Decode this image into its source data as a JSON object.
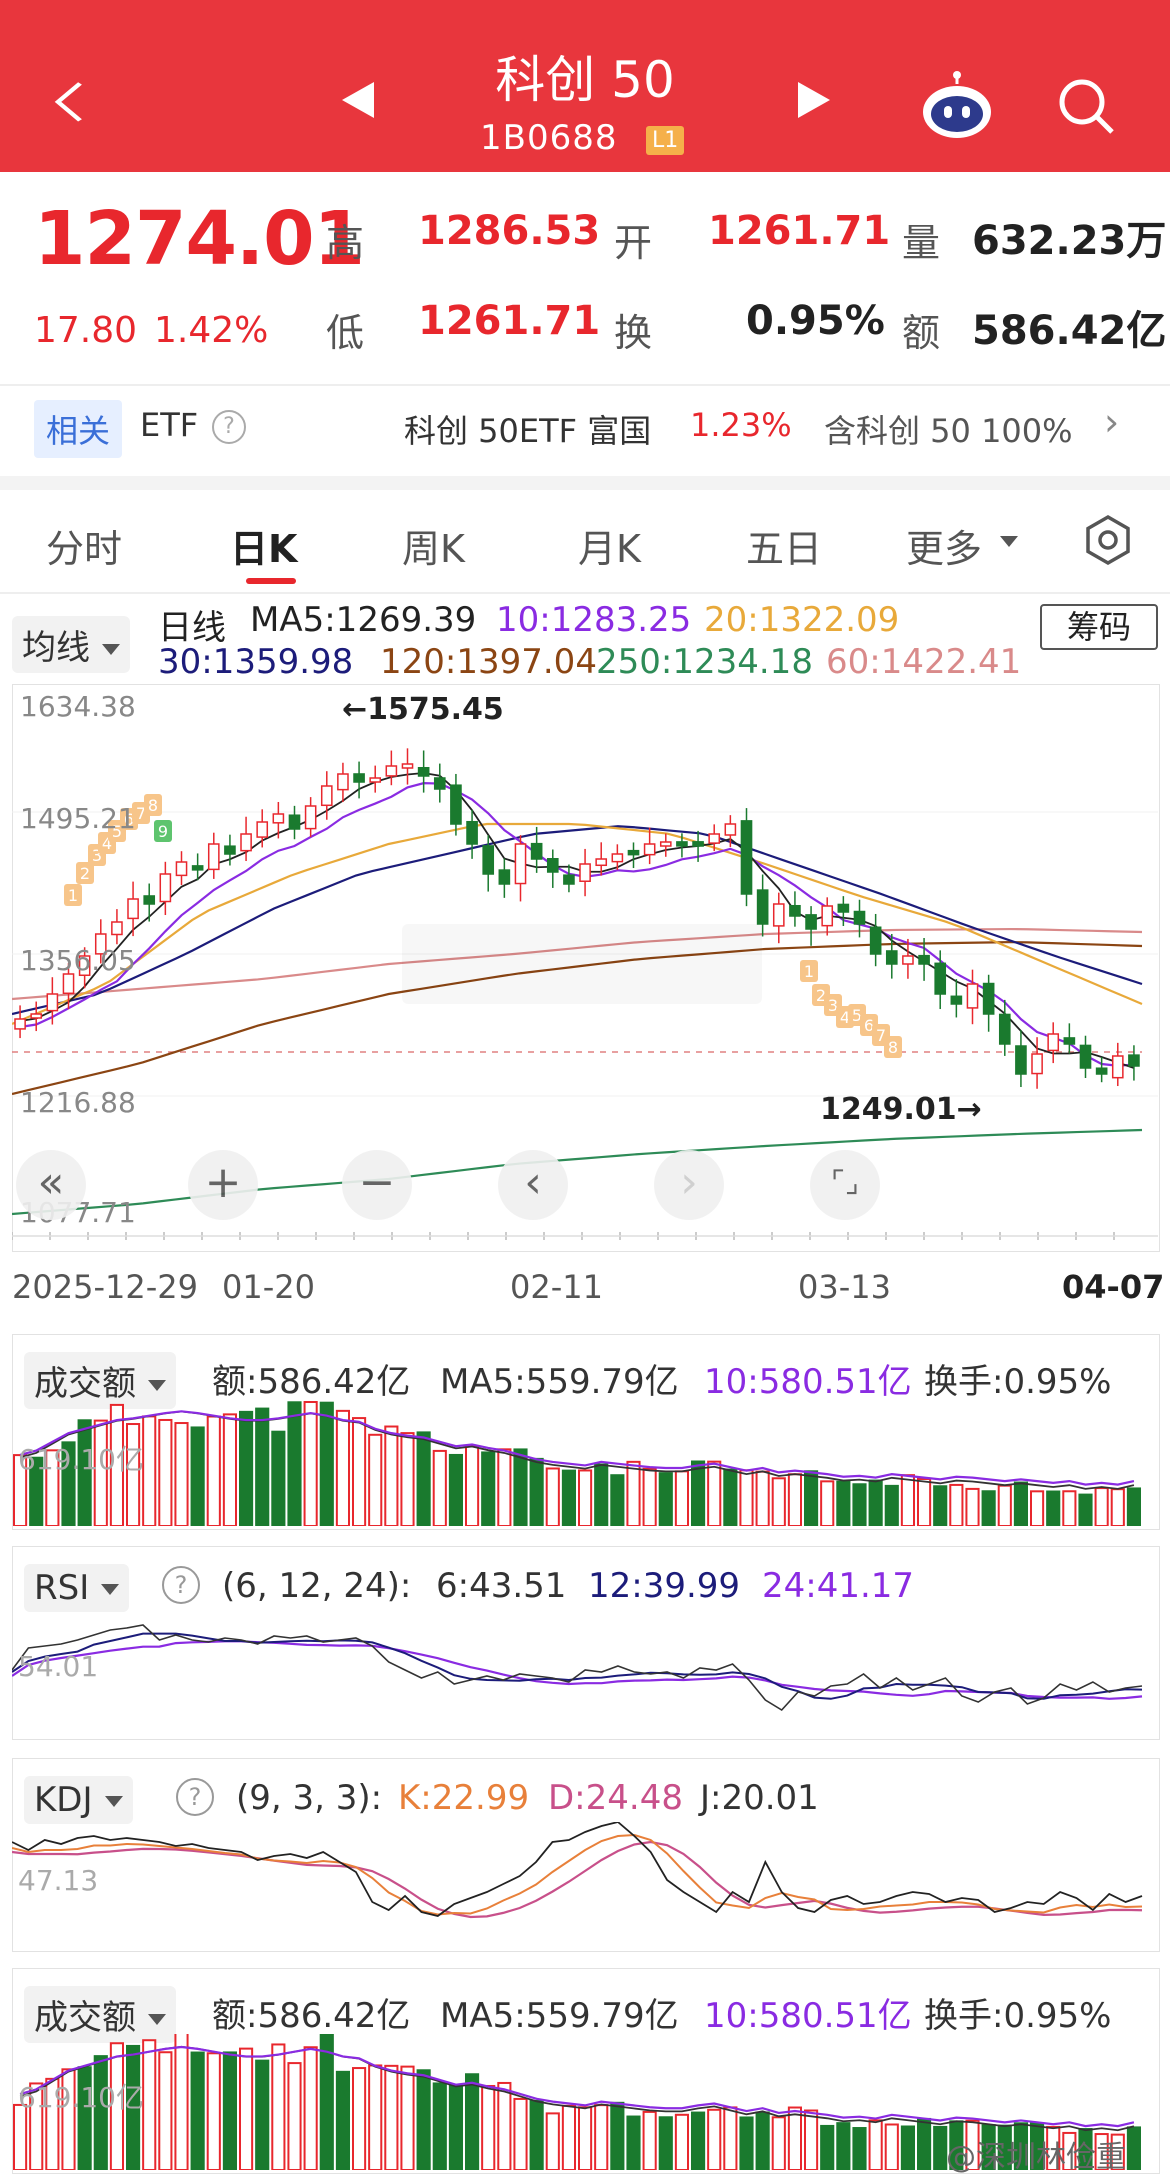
{
  "header": {
    "title": "科创 50",
    "code": "1B0688",
    "level": "L1"
  },
  "quote": {
    "price": "1274.01",
    "change": "17.80",
    "change_pct": "1.42%",
    "high_label": "高",
    "high": "1286.53",
    "open_label": "开",
    "open": "1261.71",
    "vol_label": "量",
    "vol": "632.23万",
    "low_label": "低",
    "low": "1261.71",
    "turn_label": "换",
    "turn": "0.95%",
    "amt_label": "额",
    "amt": "586.42亿"
  },
  "etf": {
    "related": "相关",
    "etf_label": "ETF",
    "help": "?",
    "name": "科创 50ETF 富国",
    "pct": "1.23%",
    "includes": "含科创 50  100%",
    "chevron": "›"
  },
  "tabs": [
    "分时",
    "日K",
    "周K",
    "月K",
    "五日",
    "更多"
  ],
  "ma_bar": {
    "selector": "均线",
    "period": "日线",
    "ma5": "MA5:1269.39",
    "ma10": "10:1283.25",
    "ma20": "20:1322.09",
    "ma30": "30:1359.98",
    "ma120": "120:1397.04",
    "ma250": "250:1234.18",
    "ma60": "60:1422.41",
    "chip_button": "筹码"
  },
  "kline": {
    "y_labels": [
      "1634.38",
      "1495.21",
      "1356.05",
      "1216.88",
      "1077.71"
    ],
    "high_note": "←1575.45",
    "low_note": "1249.01→",
    "dates": [
      "2025-12-29",
      "01-20",
      "02-11",
      "03-13",
      "04-07"
    ],
    "nav_buttons": [
      "«",
      "+",
      "−",
      "‹",
      "›",
      "⌜⌟"
    ],
    "seq_marks": [
      "1",
      "2",
      "3",
      "4",
      "5",
      "6",
      "7",
      "8",
      "9",
      "1",
      "2",
      "3",
      "4",
      "5",
      "6",
      "7",
      "8"
    ]
  },
  "amount_panel": {
    "selector": "成交额",
    "amt": "额:586.42亿",
    "ma5": "MA5:559.79亿",
    "ma10": "10:580.51亿",
    "turn": "换手:0.95%",
    "y_label": "619.10亿"
  },
  "rsi_panel": {
    "selector": "RSI",
    "help": "?",
    "params": "(6, 12, 24):",
    "rsi6": "6:43.51",
    "rsi12": "12:39.99",
    "rsi24": "24:41.17",
    "y_label": "54.01"
  },
  "kdj_panel": {
    "selector": "KDJ",
    "help": "?",
    "params": "(9, 3, 3):",
    "k": "K:22.99",
    "d": "D:24.48",
    "j": "J:20.01",
    "y_label": "47.13"
  },
  "amount_panel2": {
    "selector": "成交额",
    "amt": "额:586.42亿",
    "ma5": "MA5:559.79亿",
    "ma10": "10:580.51亿",
    "turn": "换手:0.95%",
    "y_label": "619.10亿"
  },
  "watermark": "@深圳林俭重",
  "colors": {
    "up": "#e8272d",
    "down": "#1a7a2e",
    "header": "#e8363d",
    "ma5": "#222222",
    "ma10": "#8a2be2",
    "ma20": "#e8a93a",
    "ma30": "#1c1c7a",
    "ma60": "#d98a8a",
    "ma120": "#8b4513",
    "ma250": "#2e8b57"
  }
}
